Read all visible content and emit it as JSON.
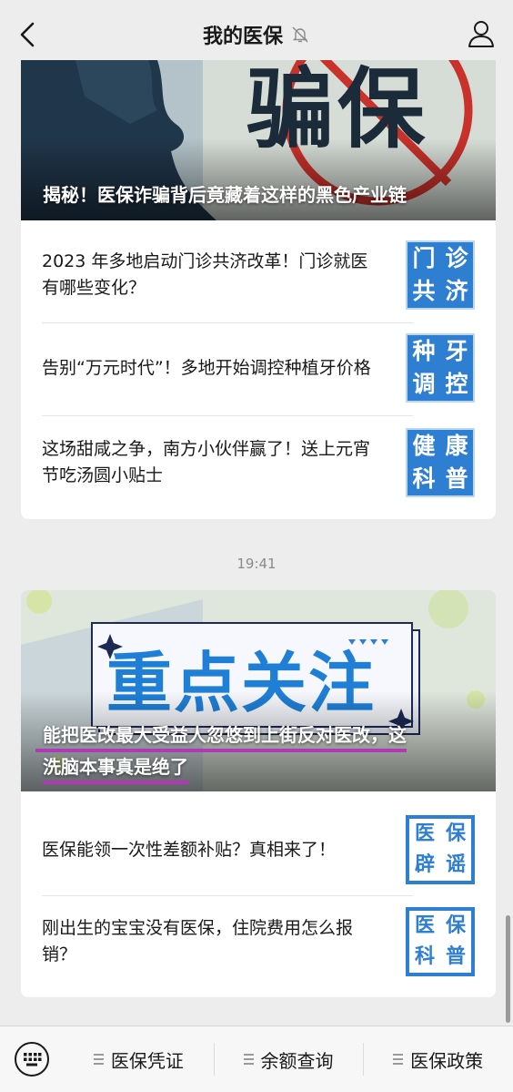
{
  "header": {
    "title": "我的医保"
  },
  "feed": {
    "group1": {
      "banner": {
        "image_text": "骗保",
        "caption": "揭秘！医保诈骗背后竟藏着这样的黑色产业链"
      },
      "items": [
        {
          "title": "2023 年多地启动门诊共济改革！门诊就医有哪些变化？",
          "thumb": [
            "门",
            "诊",
            "共",
            "济"
          ]
        },
        {
          "title": "告别“万元时代”！多地开始调控种植牙价格",
          "thumb": [
            "种",
            "牙",
            "调",
            "控"
          ]
        },
        {
          "title": "这场甜咸之争，南方小伙伴赢了！送上元宵节吃汤圆小贴士",
          "thumb": [
            "健",
            "康",
            "科",
            "普"
          ]
        }
      ]
    },
    "timestamp": "19:41",
    "group2": {
      "banner": {
        "image_text": "重点关注",
        "caption_line1": "能把医改最大受益人忽悠到上街反对医改，这",
        "caption_line2": "洗脑本事真是绝了"
      },
      "items": [
        {
          "title": "医保能领一次性差额补贴？真相来了！",
          "thumb": [
            "医",
            "保",
            "辟",
            "谣"
          ]
        },
        {
          "title": "刚出生的宝宝没有医保，住院费用怎么报销？",
          "thumb": [
            "医",
            "保",
            "科",
            "普"
          ]
        }
      ]
    }
  },
  "bottom_menu": {
    "items": [
      {
        "label": "医保凭证"
      },
      {
        "label": "余额查询"
      },
      {
        "label": "医保政策"
      }
    ]
  },
  "colors": {
    "background": "#ededed",
    "thumb_blue": "#2e7fd1",
    "banner_red": "#c9312b",
    "caption_underline": "#b03ab5"
  },
  "icons": {
    "back": "chevron-left-icon",
    "mute": "bell-muted-icon",
    "profile": "person-icon",
    "keyboard": "keyboard-icon",
    "menu": "menu-lines-icon"
  }
}
